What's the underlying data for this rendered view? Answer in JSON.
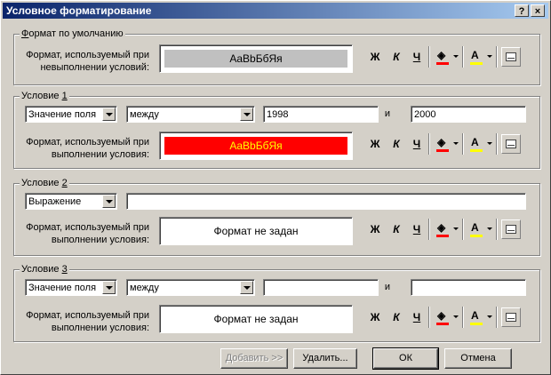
{
  "window": {
    "title": "Условное форматирование",
    "help_label": "?",
    "close_label": "×"
  },
  "default_group": {
    "legend_pre": "",
    "legend_ul": "Ф",
    "legend_post": "ормат по умолчанию",
    "label": "Формат, используемый при невыполнении условий:",
    "preview_text": "AaBbБбЯя",
    "preview_bg": "#c0c0c0",
    "preview_fg": "#000000"
  },
  "conditions": [
    {
      "legend": "Условие ",
      "legend_num": "1",
      "type_value": "Значение поля",
      "op_value": "между",
      "val1": "1998",
      "and_label": "и",
      "val2": "2000",
      "label": "Формат, используемый при выполнении условия:",
      "preview_text": "AaBbБбЯя",
      "preview_bg": "#ff0000",
      "preview_fg": "#ffff00"
    },
    {
      "legend": "Условие ",
      "legend_num": "2",
      "type_value": "Выражение",
      "formula": "",
      "label": "Формат, используемый при выполнении условия:",
      "preview_text": "Формат не задан"
    },
    {
      "legend": "Условие ",
      "legend_num": "3",
      "type_value": "Значение поля",
      "op_value": "между",
      "val1": "",
      "and_label": "и",
      "val2": "",
      "label": "Формат, используемый при выполнении условия:",
      "preview_text": "Формат не задан"
    }
  ],
  "format_buttons": {
    "bold": "Ж",
    "italic": "К",
    "underline": "Ч",
    "fill_color": "#ff0000",
    "font_color": "#ffff00"
  },
  "buttons": {
    "add": "Добавить >>",
    "delete": "Удалить...",
    "ok": "ОК",
    "cancel": "Отмена"
  }
}
